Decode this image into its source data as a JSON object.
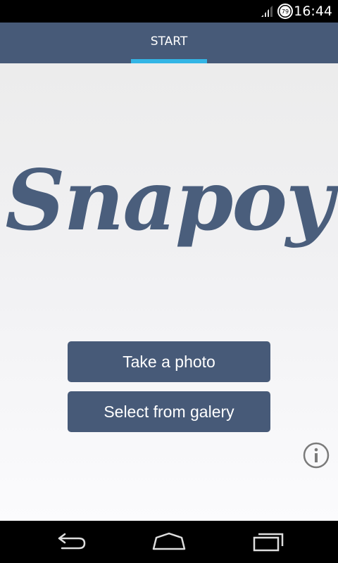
{
  "status_bar": {
    "battery_level": "79",
    "time": "16:44",
    "icons": [
      "signal-icon",
      "battery-icon"
    ]
  },
  "tabs": [
    {
      "label": "START",
      "selected": true
    }
  ],
  "logo": {
    "text": "Snapoy"
  },
  "buttons": {
    "take_photo": "Take a photo",
    "select_gallery": "Select from galery"
  },
  "info": {
    "icon": "info-icon"
  },
  "navigation": {
    "icons": [
      "back-icon",
      "home-icon",
      "recent-apps-icon"
    ]
  },
  "colors": {
    "primary": "#475a78",
    "tab_indicator": "#33b5e5",
    "logo": "#4a5e7c"
  }
}
